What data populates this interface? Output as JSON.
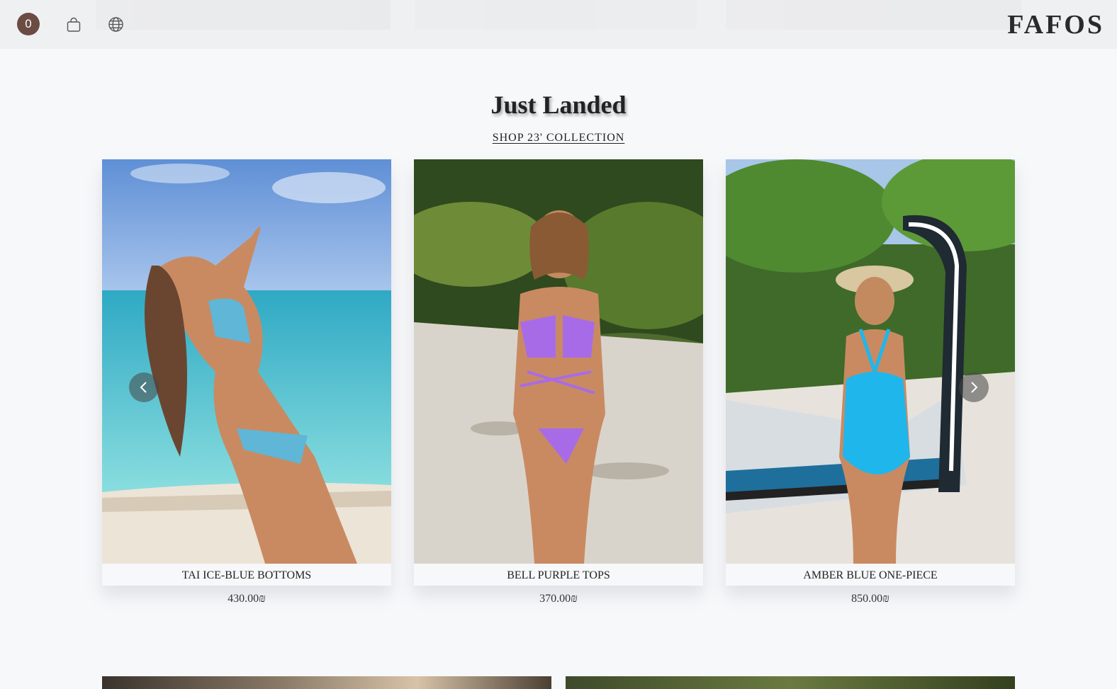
{
  "header": {
    "cart_count": "0",
    "logo": "FAFOS"
  },
  "section": {
    "title": "Just Landed",
    "link": "SHOP 23' COLLECTION"
  },
  "products": [
    {
      "name": "TAI ICE-BLUE BOTTOMS",
      "price": "430.00₪"
    },
    {
      "name": "BELL PURPLE TOPS",
      "price": "370.00₪"
    },
    {
      "name": "AMBER BLUE ONE-PIECE",
      "price": "850.00₪"
    }
  ],
  "icons": {
    "bag": "shopping-bag-icon",
    "globe": "globe-icon",
    "prev": "chevron-left-icon",
    "next": "chevron-right-icon"
  }
}
